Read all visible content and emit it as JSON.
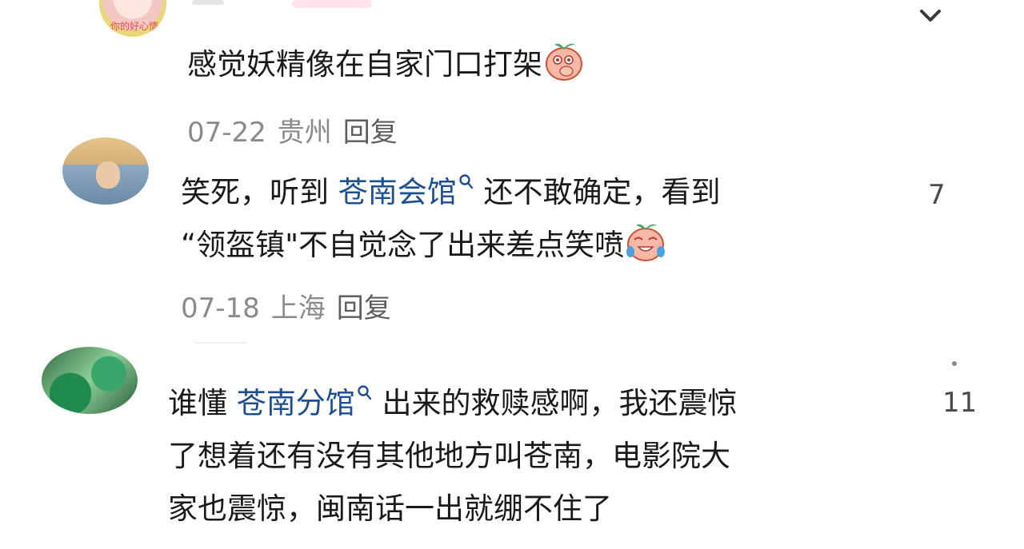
{
  "comments": [
    {
      "text": "感觉妖精像在自家门口打架",
      "emoji": "shy-blushing-peach-emoji",
      "date": "07-22",
      "location": "贵州",
      "reply": "回复",
      "avatar_caption": "你的好心情"
    },
    {
      "line1_prefix": "笑死，听到",
      "mention": "苍南会馆",
      "line1_suffix": "还不敢确定，看到",
      "line2": "“领盔镇\"不自觉念了出来差点笑喷",
      "emoji": "laughing-tears-peach-emoji",
      "date": "07-18",
      "location": "上海",
      "reply": "回复",
      "likes": "7"
    },
    {
      "line1_prefix": "谁懂",
      "mention": "苍南分馆",
      "line1_suffix": "出来的救赎感啊，我还震惊",
      "line2": "了想着还有没有其他地方叫苍南，电影院大",
      "line3": "家也震惊，闽南话一出就绷不住了",
      "likes": "11"
    }
  ],
  "icons": {
    "collapse": "chevron-down-icon",
    "mention_marker": "search-icon"
  },
  "colors": {
    "text": "#1a1a1a",
    "mention": "#1d4f91",
    "meta": "#8a8a8a"
  }
}
